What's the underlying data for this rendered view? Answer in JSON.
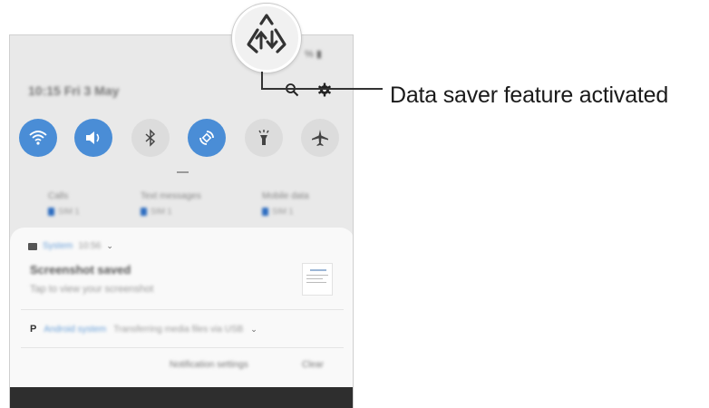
{
  "status_bar": {
    "battery_text": "% ▮"
  },
  "header": {
    "datetime": "10:15 Fri 3 May"
  },
  "quick_settings": [
    {
      "name": "wifi",
      "state": "on"
    },
    {
      "name": "sound",
      "state": "on"
    },
    {
      "name": "bluetooth",
      "state": "off"
    },
    {
      "name": "auto-rotate",
      "state": "on"
    },
    {
      "name": "flashlight",
      "state": "off"
    },
    {
      "name": "airplane-mode",
      "state": "off"
    }
  ],
  "usage": [
    {
      "label": "Calls",
      "sim": "SIM 1"
    },
    {
      "label": "Text messages",
      "sim": "SIM 1"
    },
    {
      "label": "Mobile data",
      "sim": "SIM 1"
    }
  ],
  "notifications": {
    "n1": {
      "app": "System",
      "time": "10:56",
      "title": "Screenshot saved",
      "text": "Tap to view your screenshot"
    },
    "n2": {
      "app": "Android system",
      "text": "Transferring media files via USB"
    },
    "settings_label": "Notification settings",
    "clear_label": "Clear"
  },
  "callout": {
    "label": "Data saver feature activated"
  },
  "colors": {
    "accent": "#4a8dd6",
    "toggle_off": "#dcdcdc",
    "panel": "#e9e9e9"
  }
}
